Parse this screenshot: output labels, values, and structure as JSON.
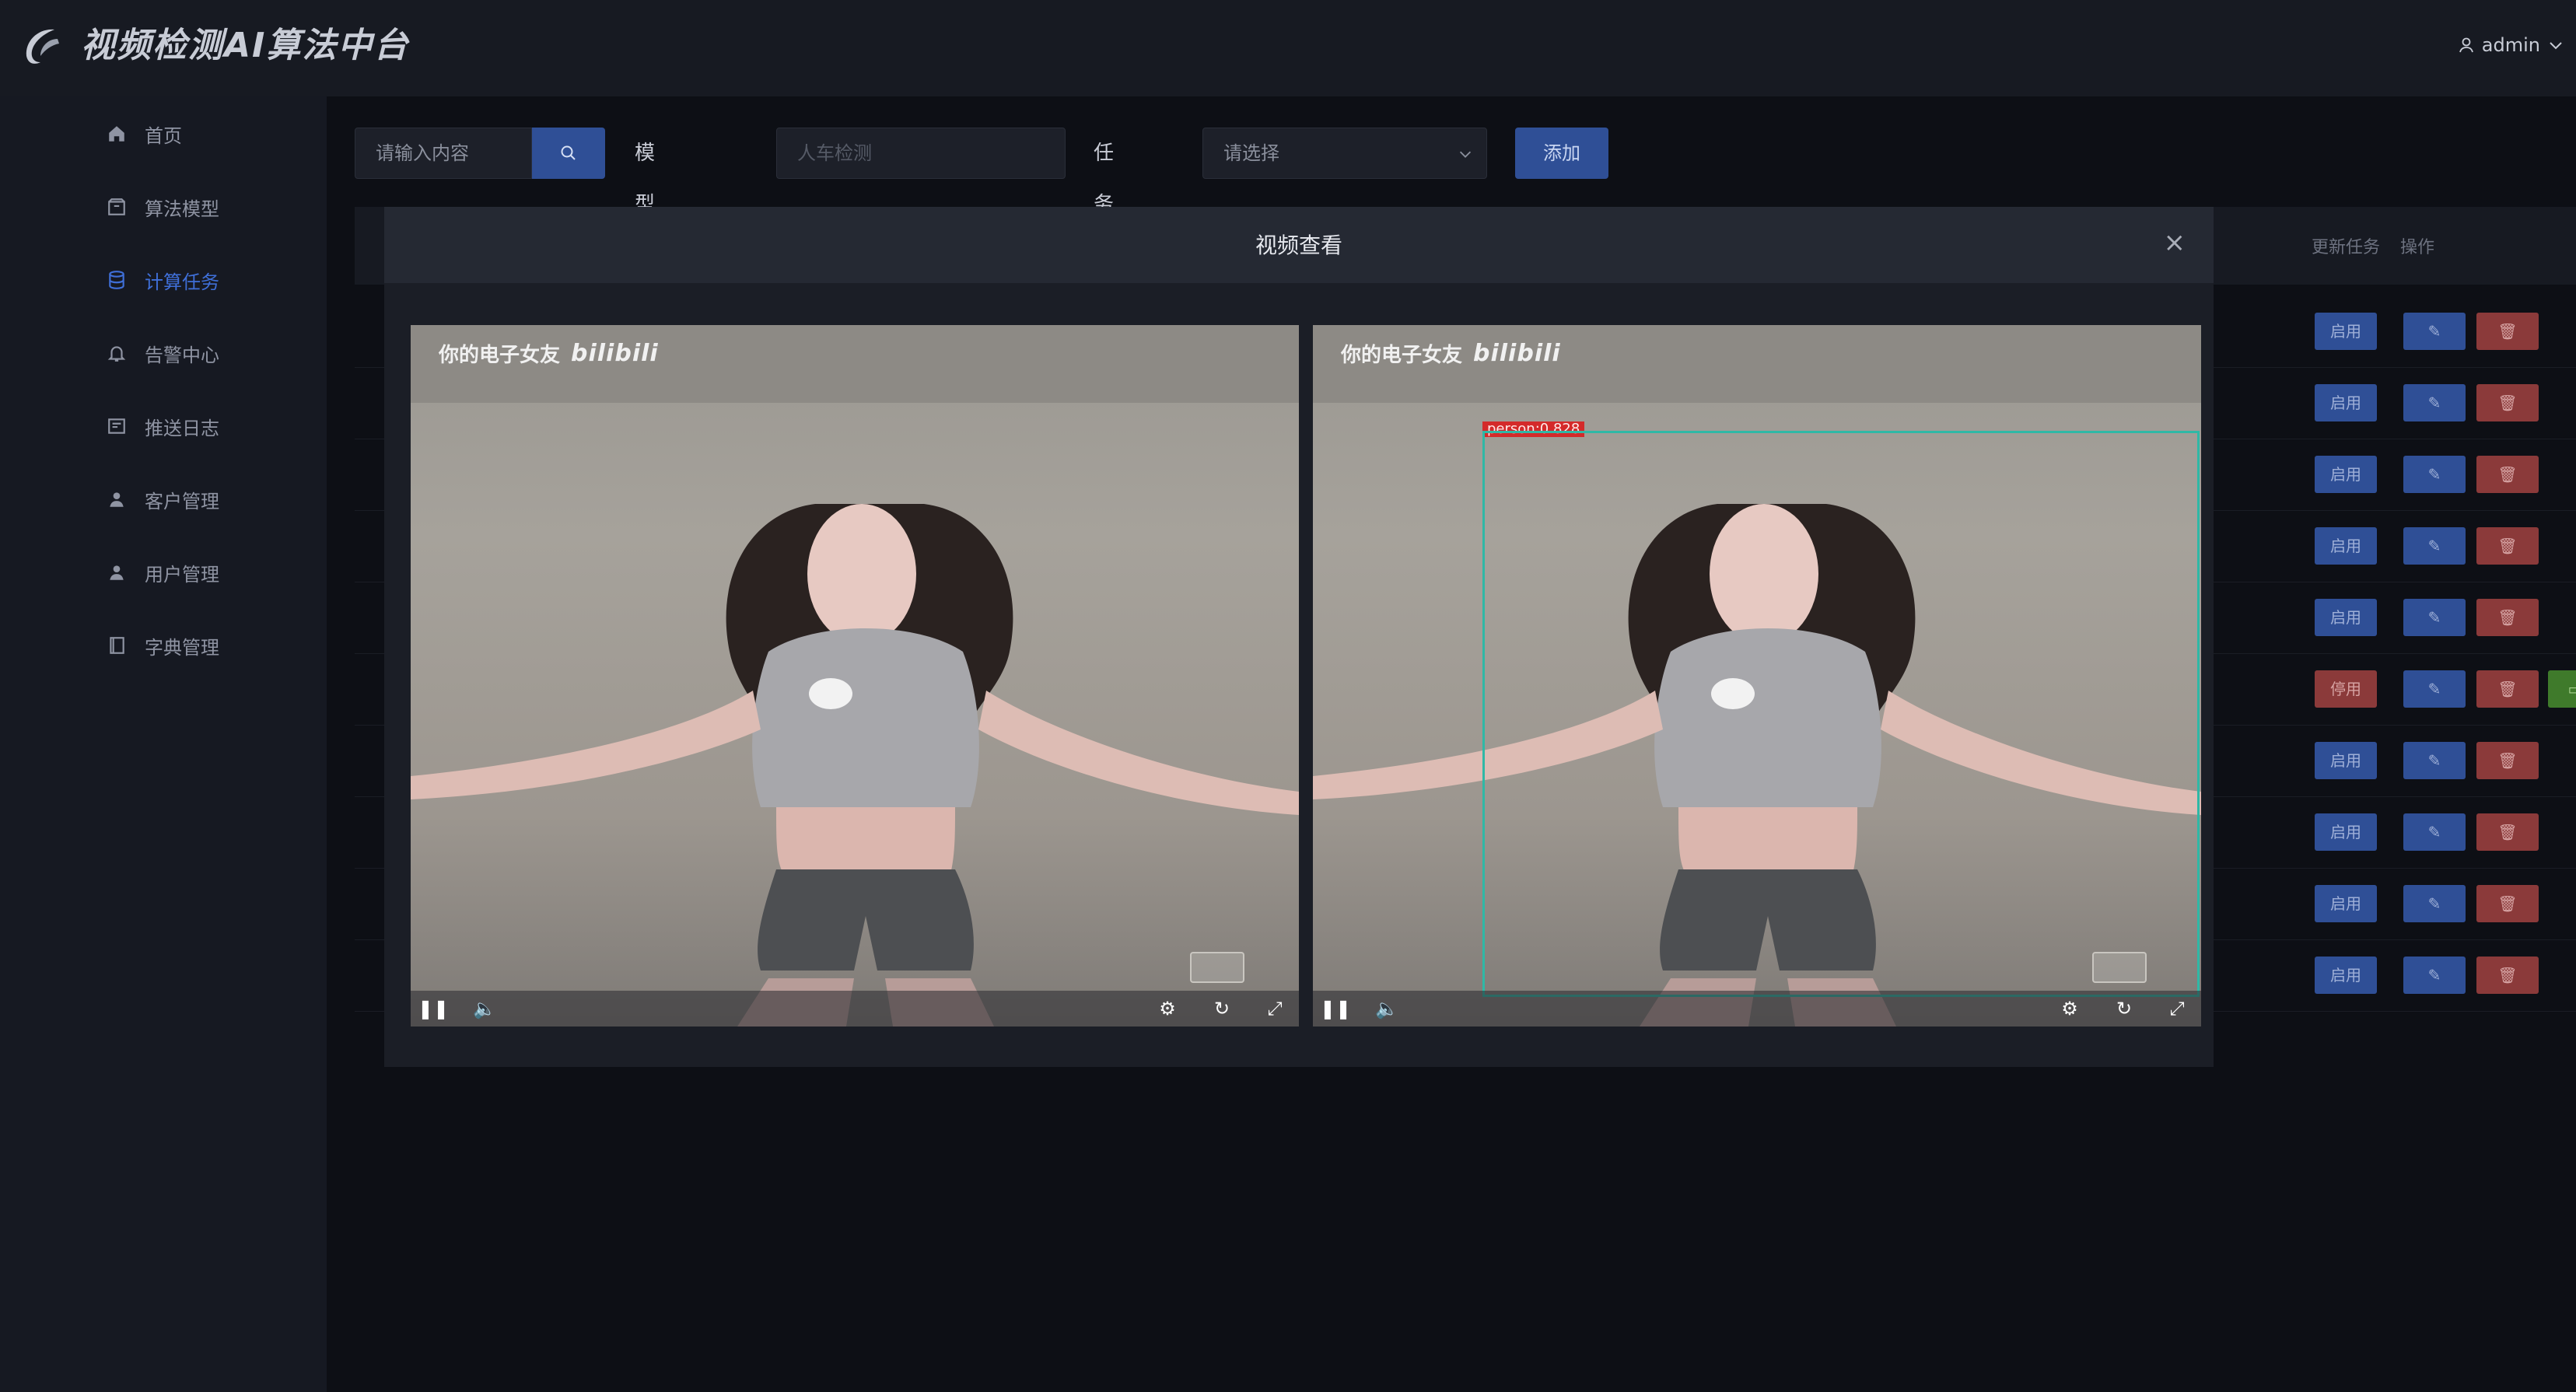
{
  "header": {
    "title": "视频检测AI算法中台",
    "user": "admin"
  },
  "sidebar": {
    "items": [
      {
        "label": "首页",
        "icon": "home-icon"
      },
      {
        "label": "算法模型",
        "icon": "box-icon"
      },
      {
        "label": "计算任务",
        "icon": "database-icon",
        "active": true
      },
      {
        "label": "告警中心",
        "icon": "bell-icon"
      },
      {
        "label": "推送日志",
        "icon": "log-icon"
      },
      {
        "label": "客户管理",
        "icon": "person-icon"
      },
      {
        "label": "用户管理",
        "icon": "person-icon"
      },
      {
        "label": "字典管理",
        "icon": "book-icon"
      }
    ]
  },
  "toolbar": {
    "search_placeholder": "请输入内容",
    "model_label": "模型名称:",
    "model_placeholder": "人车检测",
    "status_label": "任务状态:",
    "status_placeholder": "请选择",
    "add_label": "添加"
  },
  "table": {
    "headers": [
      "更新任务",
      "操作"
    ],
    "rows": [
      {
        "state": "启用"
      },
      {
        "state": "启用"
      },
      {
        "state": "启用"
      },
      {
        "state": "启用"
      },
      {
        "state": "启用"
      },
      {
        "state": "停用"
      },
      {
        "state": "启用"
      },
      {
        "state": "启用"
      },
      {
        "state": "启用"
      },
      {
        "state": "启用"
      }
    ]
  },
  "modal": {
    "title": "视频查看",
    "close": "×",
    "watermark_text": "你的电子女友",
    "watermark_brand": "bilibili",
    "detection_label": "person:0.828",
    "detection_color": "#2fb8a6"
  }
}
